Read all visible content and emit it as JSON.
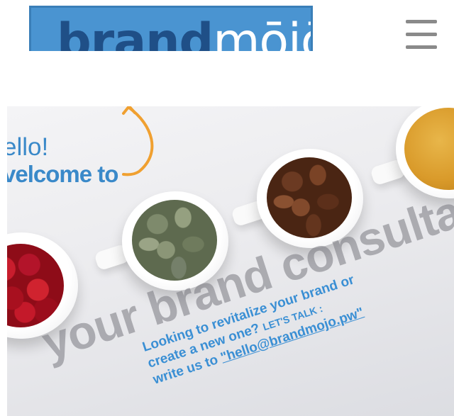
{
  "header": {
    "logo_text_bold": "brand",
    "logo_text_light": "mōjō",
    "menu_icon": "hamburger-menu-icon"
  },
  "hero": {
    "greeting": "ello!",
    "welcome": "velcome to",
    "watermark": "your brand consultan",
    "cta_line1": "Looking to revitalize your brand or",
    "cta_line2_prefix": "create a new one?",
    "cta_line2_suffix": "LET'S TALK :",
    "cta_line3_prefix": "write us to",
    "cta_email": "\"hello@brandmojo.pw\""
  },
  "colors": {
    "brand_blue": "#4a94d1",
    "logo_dark": "#1f4f87",
    "text_blue": "#3a8fd4",
    "arrow_orange": "#f0a030"
  }
}
